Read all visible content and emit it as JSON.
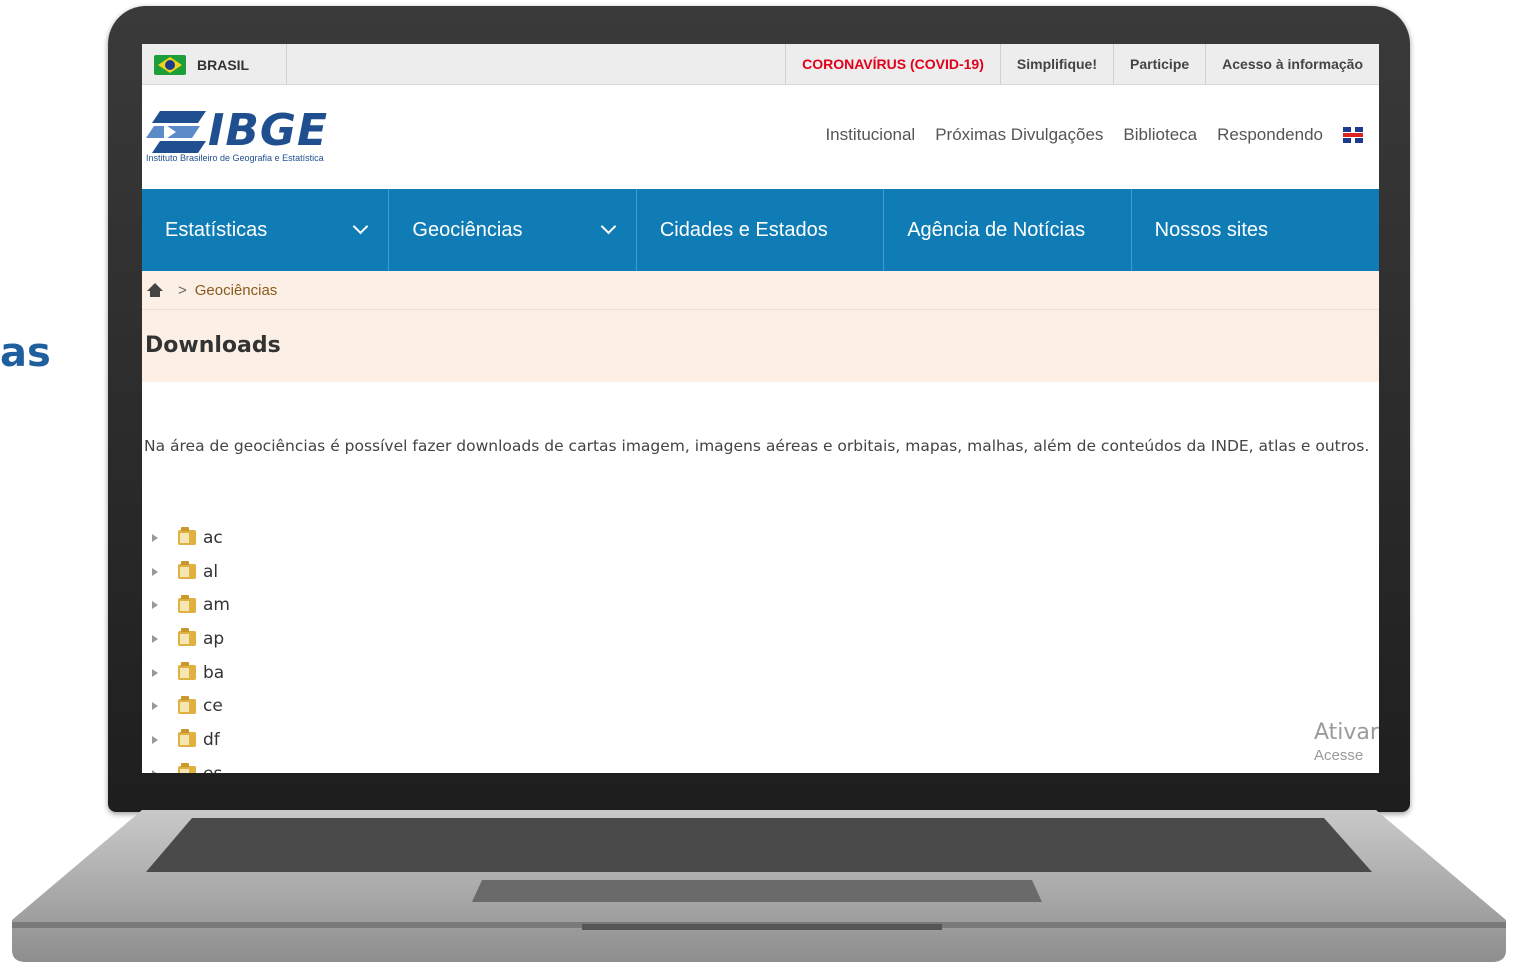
{
  "slide": {
    "fragment_text": "as"
  },
  "gov_bar": {
    "brasil_label": "BRASIL",
    "links": [
      "CORONAVÍRUS (COVID-19)",
      "Simplifique!",
      "Participe",
      "Acesso à informação"
    ]
  },
  "header": {
    "logo_text": "IBGE",
    "logo_subtitle": "Instituto Brasileiro de Geografia e Estatística",
    "links": [
      "Institucional",
      "Próximas Divulgações",
      "Biblioteca",
      "Respondendo"
    ]
  },
  "nav": {
    "items": [
      "Estatísticas",
      "Geociências",
      "Cidades e Estados",
      "Agência de Notícias",
      "Nossos sites"
    ]
  },
  "breadcrumb": {
    "current": "Geociências"
  },
  "page": {
    "title": "Downloads",
    "intro": "Na área de geociências é possível fazer downloads de cartas imagem, imagens aéreas e orbitais, mapas, malhas, além de conteúdos da INDE, atlas e outros."
  },
  "tree": {
    "items": [
      "ac",
      "al",
      "am",
      "ap",
      "ba",
      "ce",
      "df",
      "es"
    ]
  },
  "watermark": {
    "line1": "Ativar",
    "line2": "Acesse"
  }
}
